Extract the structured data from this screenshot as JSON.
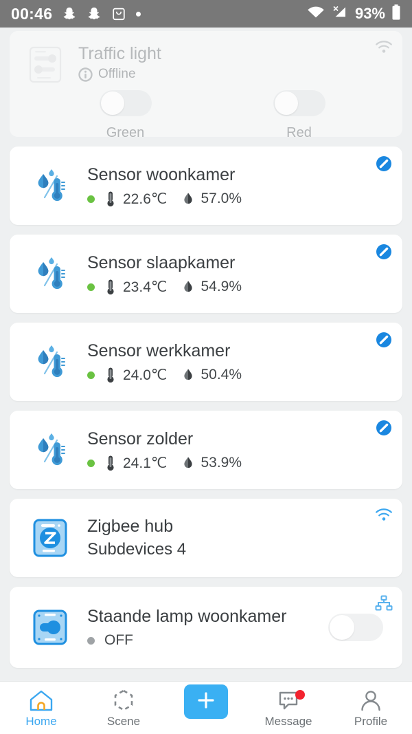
{
  "statusbar": {
    "time": "00:46",
    "battery": "93%",
    "icons": [
      "snapchat-ghost-icon",
      "snapchat-ghost-icon",
      "shopping-bag-icon",
      "dot-icon",
      "wifi-icon",
      "cell-signal-no-service-icon",
      "battery-icon"
    ]
  },
  "devices": [
    {
      "type": "offline-device",
      "title": "Traffic light",
      "status": "Offline",
      "status_icon": "info-circle-icon",
      "corner_icon": "wifi-icon",
      "switches": [
        {
          "label": "Green",
          "on": false
        },
        {
          "label": "Red",
          "on": false
        }
      ]
    },
    {
      "type": "sensor",
      "title": "Sensor woonkamer",
      "online": true,
      "temperature": "22.6℃",
      "humidity": "57.0%",
      "corner_icon": "edit-pen-icon"
    },
    {
      "type": "sensor",
      "title": "Sensor slaapkamer",
      "online": true,
      "temperature": "23.4℃",
      "humidity": "54.9%",
      "corner_icon": "edit-pen-icon"
    },
    {
      "type": "sensor",
      "title": "Sensor werkkamer",
      "online": true,
      "temperature": "24.0℃",
      "humidity": "50.4%",
      "corner_icon": "edit-pen-icon"
    },
    {
      "type": "sensor",
      "title": "Sensor zolder",
      "online": true,
      "temperature": "24.1℃",
      "humidity": "53.9%",
      "corner_icon": "edit-pen-icon"
    },
    {
      "type": "hub",
      "title": "Zigbee hub",
      "subtitle": "Subdevices 4",
      "corner_icon": "wifi-icon"
    },
    {
      "type": "lamp",
      "title": "Staande lamp woonkamer",
      "state": "OFF",
      "on": false,
      "corner_icon": "network-hierarchy-icon"
    }
  ],
  "bottomnav": [
    {
      "label": "Home",
      "icon": "home-icon",
      "active": true
    },
    {
      "label": "Scene",
      "icon": "scene-hexagon-icon",
      "active": false
    },
    {
      "label": "",
      "icon": "plus-icon",
      "active": false
    },
    {
      "label": "Message",
      "icon": "message-bubble-icon",
      "active": false,
      "badge": true
    },
    {
      "label": "Profile",
      "icon": "person-icon",
      "active": false
    }
  ],
  "colors": {
    "accent": "#3ab0f3",
    "online_dot": "#6ac242",
    "offline_dot": "#9fa3a6",
    "badge": "#f3232f",
    "statusbar_bg": "#787878",
    "page_bg": "#eef0f1"
  }
}
